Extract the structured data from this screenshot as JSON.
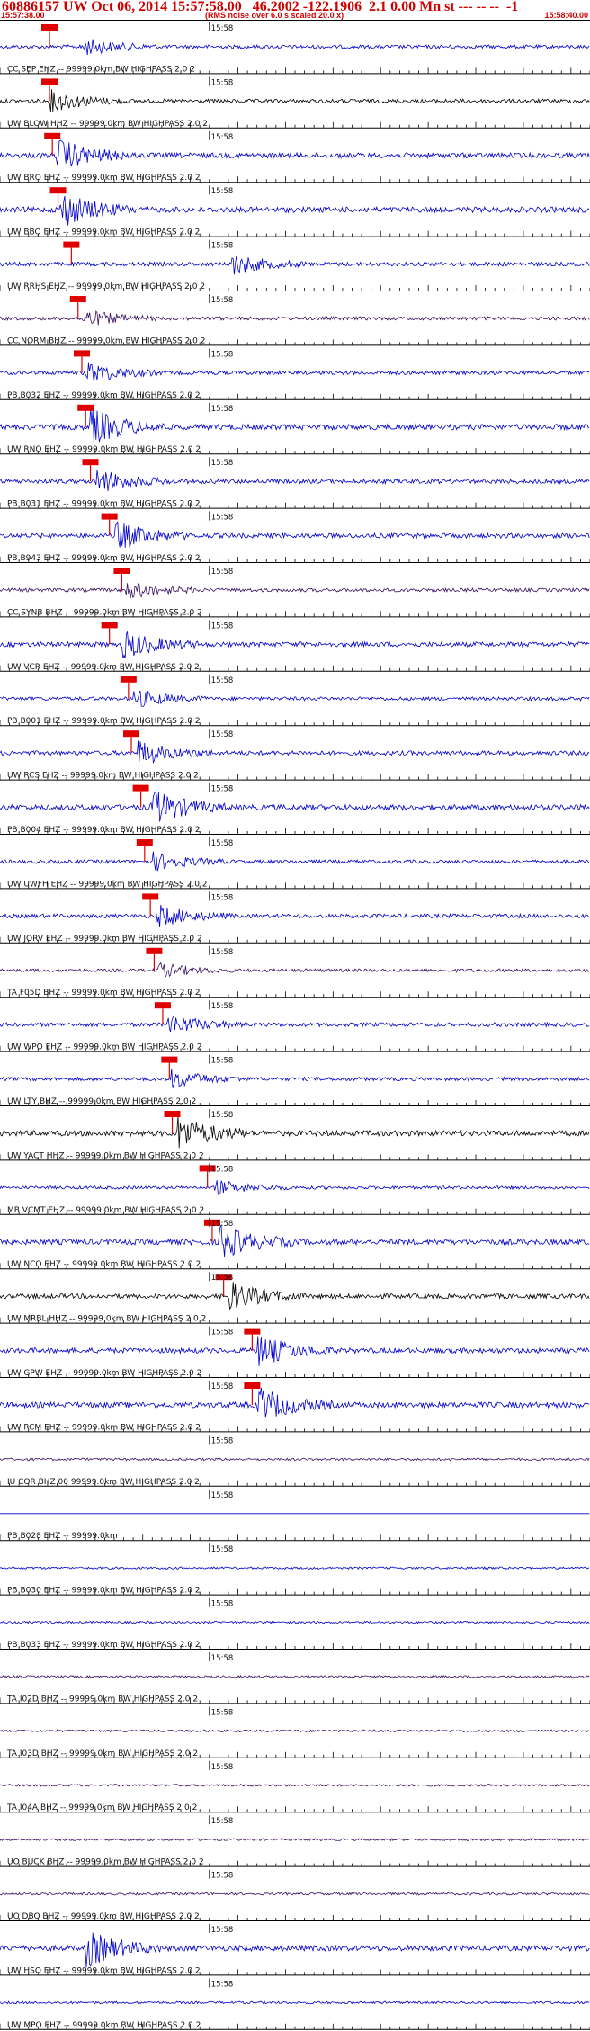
{
  "header": {
    "title": "60886157 UW Oct 06, 2014 15:57:58.00   46.2002 -122.1906  2.1 0.00 Mn st --- -- --  -1",
    "start_time": "15:57:38.00",
    "end_time": "15:58:40.00",
    "rms_note": "(RMS noise over 6.0 s scaled 20.0 x)"
  },
  "colors": {
    "header_text": "#d00000",
    "trace_blue": "#0000cc",
    "trace_black": "#000000",
    "trace_purple": "#3a1060",
    "pick_marker": "#e00000",
    "separator": "#000000"
  },
  "chart_data": {
    "type": "line",
    "title": "60886157 UW Oct 06, 2014 15:57:58.00   46.2002 -122.1906  2.1 0.00 Mn st --- -- --  -1",
    "x_range": [
      "15:57:38.00",
      "15:58:40.00"
    ],
    "time_mark_label": "15:58",
    "time_mark_second": 22,
    "traces": [
      {
        "label": "CC SEP EHZ -- 99999.0km BW  HIGHPASS  2.0  2",
        "color": "blue",
        "pick_second": 5.2,
        "burst_second": 8.5,
        "amp": 0.5
      },
      {
        "label": "UW BLOW HHZ -- 99999.0km BW  HIGHPASS  2.0  2",
        "color": "black",
        "pick_second": 5.2,
        "burst_second": 5.3,
        "amp": 0.6
      },
      {
        "label": "UW BRO EHZ -- 99999.0km BW  HIGHPASS  2.0  2",
        "color": "blue",
        "pick_second": 5.5,
        "burst_second": 6.0,
        "amp": 0.9
      },
      {
        "label": "UW BBO EHZ -- 99999.0km BW  HIGHPASS  2.0  2",
        "color": "blue",
        "pick_second": 6.1,
        "burst_second": 6.3,
        "amp": 1.0
      },
      {
        "label": "UW RRHS EHZ -- 99999.0km BW  HIGHPASS  2.0  2",
        "color": "blue",
        "pick_second": 7.5,
        "burst_second": 24.1,
        "amp": 0.6
      },
      {
        "label": "CC NORM BHZ -- 99999.0km BW  HIGHPASS  2.0  2",
        "color": "purple",
        "pick_second": 8.2,
        "burst_second": 8.6,
        "amp": 0.5
      },
      {
        "label": "PB B032 EHZ -- 99999.0km BW  HIGHPASS  2.0  2",
        "color": "blue",
        "pick_second": 8.6,
        "burst_second": 9.0,
        "amp": 0.6
      },
      {
        "label": "UW RNO EHZ -- 99999.0km BW  HIGHPASS  2.0  2",
        "color": "blue",
        "pick_second": 9.0,
        "burst_second": 9.5,
        "amp": 1.0
      },
      {
        "label": "PB B031 EHZ -- 99999.0km BW  HIGHPASS  2.0  2",
        "color": "blue",
        "pick_second": 9.5,
        "burst_second": 10.0,
        "amp": 0.7
      },
      {
        "label": "PB B943 EHZ -- 99999.0km BW  HIGHPASS  2.0  2",
        "color": "blue",
        "pick_second": 11.5,
        "burst_second": 12.0,
        "amp": 0.8
      },
      {
        "label": "CC SYNB BHZ -- 99999.0km BW  HIGHPASS  2.0  2",
        "color": "purple",
        "pick_second": 12.8,
        "burst_second": 13.2,
        "amp": 0.5
      },
      {
        "label": "UW VCR EHZ -- 99999.0km BW  HIGHPASS  2.0  2",
        "color": "blue",
        "pick_second": 11.5,
        "burst_second": 12.8,
        "amp": 0.8
      },
      {
        "label": "PB B001 EHZ -- 99999.0km BW  HIGHPASS  2.0  2",
        "color": "blue",
        "pick_second": 13.5,
        "burst_second": 14.0,
        "amp": 0.5
      },
      {
        "label": "UW RCS EHZ -- 99999.0km BW  HIGHPASS  2.0  2",
        "color": "blue",
        "pick_second": 13.8,
        "burst_second": 14.3,
        "amp": 0.7
      },
      {
        "label": "PB B004 EHZ -- 99999.0km BW  HIGHPASS  2.0  2",
        "color": "blue",
        "pick_second": 14.8,
        "burst_second": 15.8,
        "amp": 1.0
      },
      {
        "label": "UW UWFH EHZ -- 99999.0km BW  HIGHPASS  2.0  2",
        "color": "blue",
        "pick_second": 15.2,
        "burst_second": 16.0,
        "amp": 0.5
      },
      {
        "label": "UW JORV EHZ -- 99999.0km BW  HIGHPASS  2.0  2",
        "color": "blue",
        "pick_second": 15.8,
        "burst_second": 16.5,
        "amp": 0.6
      },
      {
        "label": "TA F05D BHZ -- 99999.0km BW  HIGHPASS  2.0  2",
        "color": "purple",
        "pick_second": 16.2,
        "burst_second": 16.5,
        "amp": 0.4
      },
      {
        "label": "UW WPO EHZ -- 99999.0km BW  HIGHPASS  2.0  2",
        "color": "blue",
        "pick_second": 17.1,
        "burst_second": 17.5,
        "amp": 0.6
      },
      {
        "label": "UW LTY BHZ -- 99999.0km BW  HIGHPASS  2.0  2",
        "color": "blue",
        "pick_second": 17.8,
        "burst_second": 18.0,
        "amp": 0.5
      },
      {
        "label": "UW YACT HHZ -- 99999.0km BW  HIGHPASS  2.0  2",
        "color": "black",
        "pick_second": 18.1,
        "burst_second": 18.5,
        "amp": 1.0
      },
      {
        "label": "MB VCMT EHZ -- 99999.0km BW  HIGHPASS  2.0  2",
        "color": "blue",
        "pick_second": 21.8,
        "burst_second": 22.5,
        "amp": 0.4
      },
      {
        "label": "UW NCO EHZ -- 99999.0km BW  HIGHPASS  2.0  2",
        "color": "blue",
        "pick_second": 22.3,
        "burst_second": 23.0,
        "amp": 1.0
      },
      {
        "label": "UW MRBL HHZ -- 99999.0km BW  HIGHPASS  2.0  2",
        "color": "black",
        "pick_second": 23.5,
        "burst_second": 24.0,
        "amp": 0.8
      },
      {
        "label": "UW GPW EHZ -- 99999.0km BW  HIGHPASS  2.0  2",
        "color": "blue",
        "pick_second": 26.5,
        "burst_second": 27.0,
        "amp": 0.9
      },
      {
        "label": "UW RCM EHZ -- 99999.0km BW  HIGHPASS  2.0  2",
        "color": "blue",
        "pick_second": 26.5,
        "burst_second": 27.0,
        "amp": 1.0
      },
      {
        "label": "IU COR BHZ 00 99999.0km BW  HIGHPASS  2.0  2",
        "color": "purple",
        "pick_second": null,
        "burst_second": null,
        "amp": 0.2
      },
      {
        "label": "PB B028 EHZ -- 99999.0km",
        "color": "blue",
        "pick_second": null,
        "burst_second": null,
        "amp": 0.0
      },
      {
        "label": "PB B030 EHZ -- 99999.0km BW  HIGHPASS  2.0  2",
        "color": "blue",
        "pick_second": null,
        "burst_second": null,
        "amp": 0.15
      },
      {
        "label": "PB B033 EHZ -- 99999.0km BW  HIGHPASS  2.0  2",
        "color": "blue",
        "pick_second": null,
        "burst_second": null,
        "amp": 0.15
      },
      {
        "label": "TA I02D BHZ -- 99999.0km BW  HIGHPASS  2.0  2",
        "color": "purple",
        "pick_second": null,
        "burst_second": null,
        "amp": 0.15
      },
      {
        "label": "TA I03D BHZ -- 99999.0km BW  HIGHPASS  2.0  2",
        "color": "purple",
        "pick_second": null,
        "burst_second": null,
        "amp": 0.15
      },
      {
        "label": "TA I04A BHZ -- 99999.0km BW  HIGHPASS  2.0  2",
        "color": "purple",
        "pick_second": null,
        "burst_second": null,
        "amp": 0.15
      },
      {
        "label": "UO BUCK BHZ -- 99999.0km BW  HIGHPASS  2.0  2",
        "color": "purple",
        "pick_second": null,
        "burst_second": null,
        "amp": 0.15
      },
      {
        "label": "UO DBO BHZ -- 99999.0km BW  HIGHPASS  2.0  2",
        "color": "purple",
        "pick_second": null,
        "burst_second": null,
        "amp": 0.2
      },
      {
        "label": "UW HSO EHZ -- 99999.0km BW  HIGHPASS  2.0  2",
        "color": "blue",
        "pick_second": null,
        "burst_second": 9.0,
        "amp": 1.0
      },
      {
        "label": "UW MPO EHZ -- 99999.0km BW  HIGHPASS  2.0  2",
        "color": "blue",
        "pick_second": null,
        "burst_second": null,
        "amp": 0.2
      }
    ]
  }
}
